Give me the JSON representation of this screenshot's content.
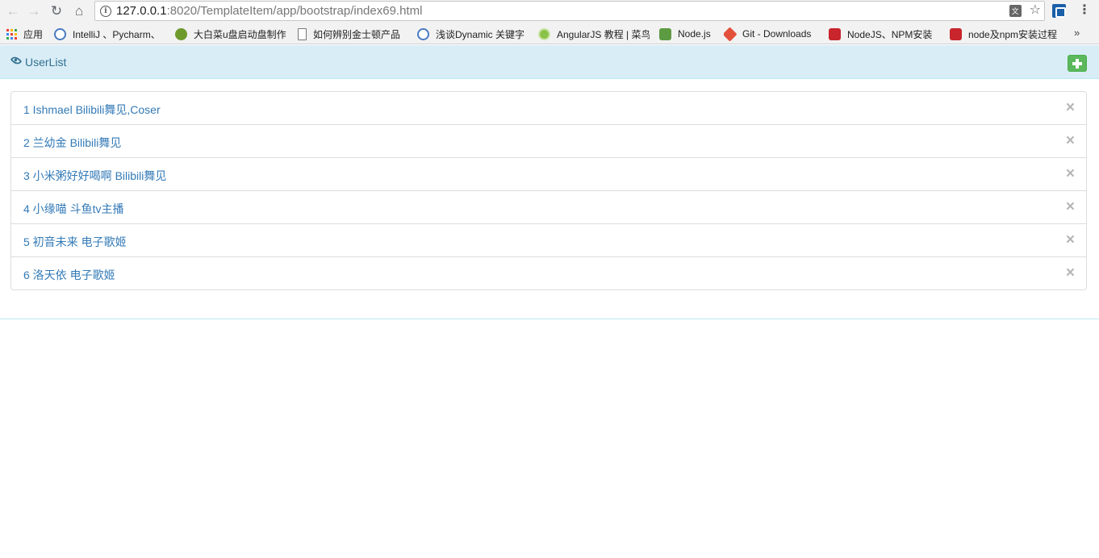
{
  "browser": {
    "url_host": "127.0.0.1",
    "url_path": ":8020/TemplateItem/app/bootstrap/index69.html"
  },
  "bookmarks": [
    {
      "label": "应用",
      "icon": "apps-grid-icon"
    },
    {
      "label": "IntelliJ 、Pycharm、",
      "icon": "chrome-icon"
    },
    {
      "label": "大白菜u盘启动盘制作",
      "icon": "mushroom-icon"
    },
    {
      "label": "如何辨别金士顿产品",
      "icon": "page-icon"
    },
    {
      "label": "浅谈Dynamic 关键字",
      "icon": "chrome-icon"
    },
    {
      "label": "AngularJS 教程 | 菜鸟",
      "icon": "angular-icon"
    },
    {
      "label": "Node.js",
      "icon": "node-icon"
    },
    {
      "label": "Git - Downloads",
      "icon": "git-icon"
    },
    {
      "label": "NodeJS、NPM安装",
      "icon": "c-icon"
    },
    {
      "label": "node及npm安装过程",
      "icon": "c-icon"
    }
  ],
  "panel": {
    "title": "UserList"
  },
  "users": [
    "1 Ishmael Bilibili舞见,Coser",
    "2 兰幼金 Bilibili舞见",
    "3 小米粥好好喝啊 Bilibili舞见",
    "4 小缘喵 斗鱼tv主播",
    "5 初音未来 电子歌姬",
    "6 洛天依 电子歌姬"
  ],
  "colors": {
    "panel_bg": "#d9edf7",
    "panel_text": "#31708f",
    "link": "#337ab7",
    "success": "#5cb85c"
  }
}
